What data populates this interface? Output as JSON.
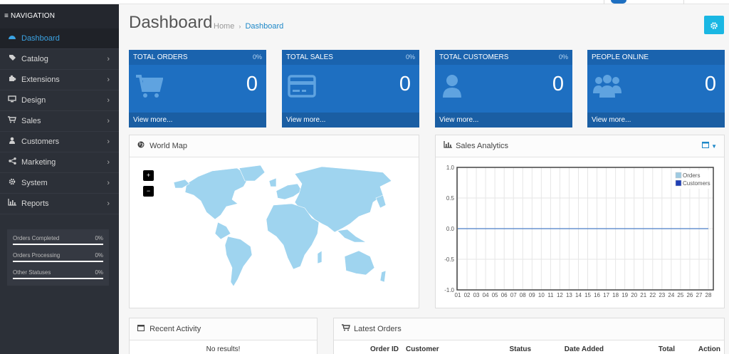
{
  "navigation": {
    "header": "≡ NAVIGATION",
    "items": [
      {
        "label": "Dashboard",
        "icon": "dashboard-icon",
        "active": true
      },
      {
        "label": "Catalog",
        "icon": "tag-icon"
      },
      {
        "label": "Extensions",
        "icon": "puzzle-icon"
      },
      {
        "label": "Design",
        "icon": "monitor-icon"
      },
      {
        "label": "Sales",
        "icon": "cart-icon"
      },
      {
        "label": "Customers",
        "icon": "user-icon"
      },
      {
        "label": "Marketing",
        "icon": "share-icon"
      },
      {
        "label": "System",
        "icon": "gear-icon"
      },
      {
        "label": "Reports",
        "icon": "bar-chart-icon"
      }
    ],
    "stats": [
      {
        "label": "Orders Completed",
        "value": "0%"
      },
      {
        "label": "Orders Processing",
        "value": "0%"
      },
      {
        "label": "Other Statuses",
        "value": "0%"
      }
    ]
  },
  "header": {
    "title": "Dashboard",
    "breadcrumb": [
      "Home",
      "Dashboard"
    ],
    "breadcrumb_sep": "›"
  },
  "tiles": [
    {
      "label": "TOTAL ORDERS",
      "pct": "0%",
      "value": "0",
      "link": "View more...",
      "icon": "cart-icon"
    },
    {
      "label": "TOTAL SALES",
      "pct": "0%",
      "value": "0",
      "link": "View more...",
      "icon": "credit-card-icon"
    },
    {
      "label": "TOTAL CUSTOMERS",
      "pct": "0%",
      "value": "0",
      "link": "View more...",
      "icon": "user-icon"
    },
    {
      "label": "PEOPLE ONLINE",
      "pct": "",
      "value": "0",
      "link": "View more...",
      "icon": "users-icon"
    }
  ],
  "world_map": {
    "title": "World Map",
    "zoom_in": "+",
    "zoom_out": "−"
  },
  "sales_analytics": {
    "title": "Sales Analytics"
  },
  "recent_activity": {
    "title": "Recent Activity",
    "empty": "No results!"
  },
  "latest_orders": {
    "title": "Latest Orders",
    "columns": [
      "Order ID",
      "Customer",
      "Status",
      "Date Added",
      "Total",
      "Action"
    ]
  },
  "colors": {
    "accent": "#1e6fc1",
    "sidebar": "#2c3038",
    "gear_button": "#1ab7e3",
    "orders_series": "#9ecae1",
    "customers_series": "#1f3fb4"
  },
  "chart_data": {
    "type": "line",
    "x": [
      "01",
      "02",
      "03",
      "04",
      "05",
      "06",
      "07",
      "08",
      "09",
      "10",
      "11",
      "12",
      "13",
      "14",
      "15",
      "16",
      "17",
      "18",
      "19",
      "20",
      "21",
      "22",
      "23",
      "24",
      "25",
      "26",
      "27",
      "28"
    ],
    "series": [
      {
        "name": "Orders",
        "values": [
          0,
          0,
          0,
          0,
          0,
          0,
          0,
          0,
          0,
          0,
          0,
          0,
          0,
          0,
          0,
          0,
          0,
          0,
          0,
          0,
          0,
          0,
          0,
          0,
          0,
          0,
          0,
          0
        ]
      },
      {
        "name": "Customers",
        "values": [
          0,
          0,
          0,
          0,
          0,
          0,
          0,
          0,
          0,
          0,
          0,
          0,
          0,
          0,
          0,
          0,
          0,
          0,
          0,
          0,
          0,
          0,
          0,
          0,
          0,
          0,
          0,
          0
        ]
      }
    ],
    "y_ticks": [
      "1.0",
      "0.5",
      "0.0",
      "-0.5",
      "-1.0"
    ],
    "ylim": [
      -1,
      1
    ],
    "grid": true,
    "legend": "top-right",
    "title": "",
    "xlabel": "",
    "ylabel": ""
  }
}
